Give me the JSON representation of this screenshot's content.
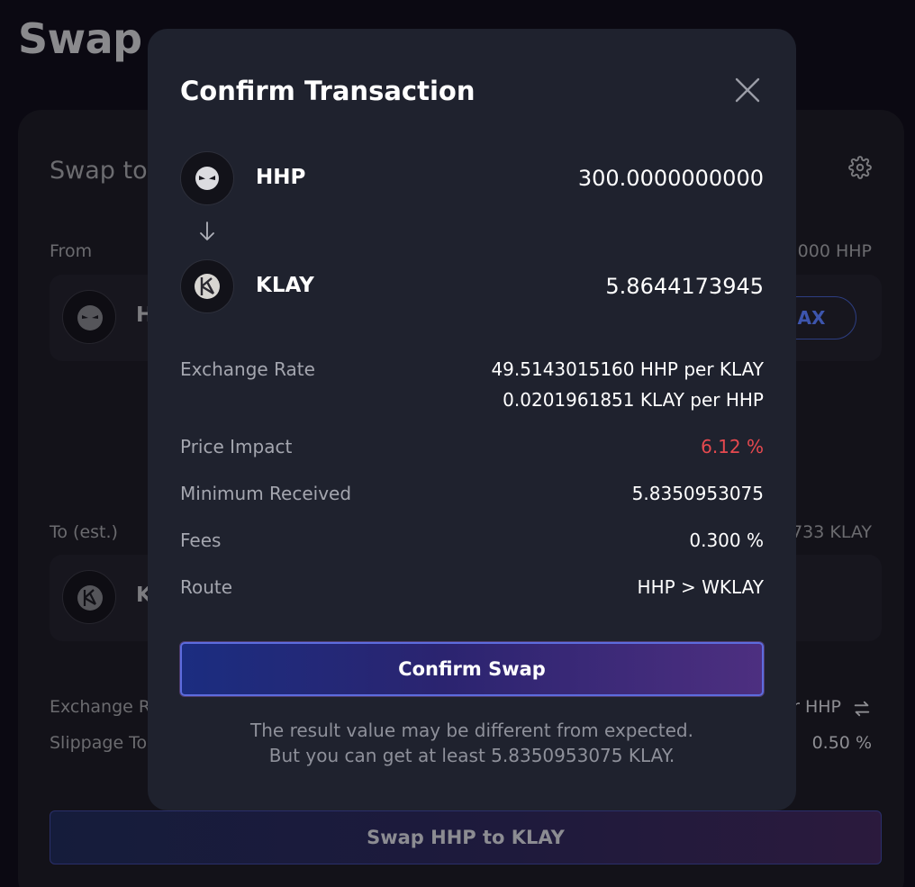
{
  "background": {
    "page_title": "Swap",
    "card_heading": "Swap to",
    "from_label": "From",
    "from_balance": "000 HHP",
    "from_token_letter": "H",
    "max_label": "MAX",
    "to_label": "To (est.)",
    "to_balance": "733 KLAY",
    "to_token_letter": "K",
    "exchange_rate_label": "Exchange R",
    "exchange_rate_value": "r HHP",
    "slippage_label": "Slippage To",
    "slippage_value": "0.50 %",
    "swap_button_label": "Swap HHP to KLAY"
  },
  "modal": {
    "title": "Confirm Transaction",
    "from_token": {
      "symbol": "HHP",
      "amount": "300.0000000000"
    },
    "to_token": {
      "symbol": "KLAY",
      "amount": "5.8644173945"
    },
    "details": {
      "exchange_rate_label": "Exchange Rate",
      "exchange_rate_line1": "49.5143015160 HHP per KLAY",
      "exchange_rate_line2": "0.0201961851 KLAY per HHP",
      "price_impact_label": "Price Impact",
      "price_impact_value": "6.12 %",
      "minimum_received_label": "Minimum Received",
      "minimum_received_value": "5.8350953075",
      "fees_label": "Fees",
      "fees_value": "0.300 %",
      "route_label": "Route",
      "route_value": "HHP > WKLAY"
    },
    "confirm_button_label": "Confirm Swap",
    "note_line1": "The result value may be different from expected.",
    "note_line2": "But you can get at least 5.8350953075 KLAY."
  },
  "colors": {
    "modal_bg": "#1f222e",
    "price_impact_red": "#e6494f",
    "confirm_gradient_start": "#1b2d80",
    "confirm_gradient_end": "#4d2f80"
  },
  "icons": {
    "close": "close-icon",
    "arrow": "arrow-down-icon",
    "hhp": "hhp-token-icon",
    "klay": "klay-token-icon",
    "settings": "gear-icon",
    "swap_direction": "swap-arrows-icon"
  }
}
